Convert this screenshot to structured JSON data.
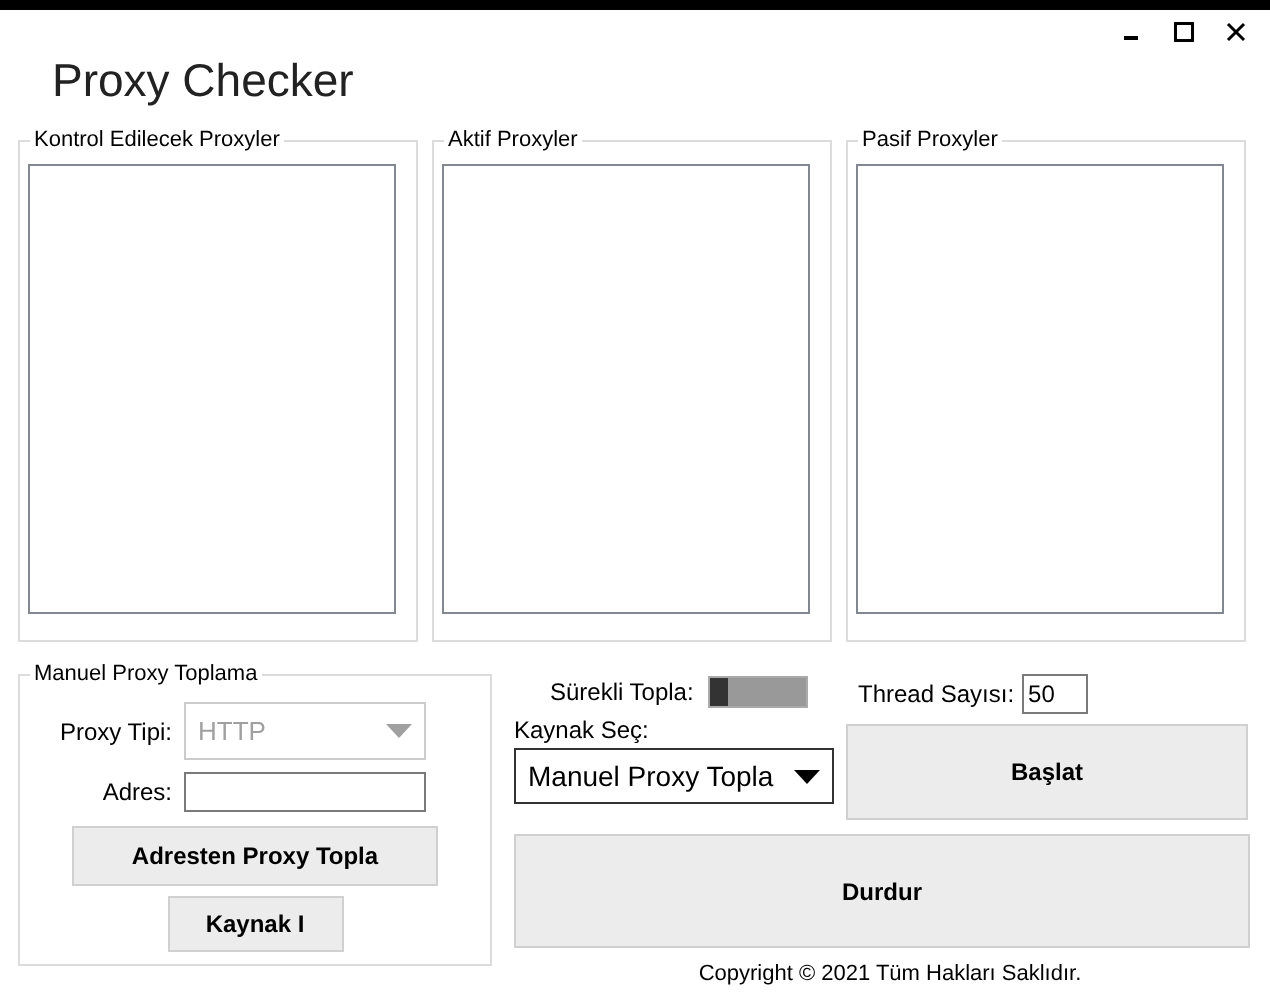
{
  "window": {
    "title": "Proxy Checker"
  },
  "lists": [
    {
      "label": "Kontrol Edilecek Proxyler"
    },
    {
      "label": "Aktif Proxyler"
    },
    {
      "label": "Pasif Proxyler"
    }
  ],
  "manual": {
    "label": "Manuel Proxy Toplama",
    "proxy_type": {
      "label": "Proxy Tipi:",
      "value": "HTTP",
      "disabled": true
    },
    "address": {
      "label": "Adres:"
    },
    "collect_button": "Adresten Proxy Topla",
    "source_button": "Kaynak I"
  },
  "continuous": {
    "label": "Sürekli Topla:",
    "on": false
  },
  "source": {
    "label": "Kaynak Seç:",
    "value": "Manuel Proxy Topla"
  },
  "threads": {
    "label": "Thread Sayısı:",
    "value": "50"
  },
  "start_button": "Başlat",
  "stop_button": "Durdur",
  "footer": "Copyright © 2021 Tüm Hakları Saklıdır."
}
